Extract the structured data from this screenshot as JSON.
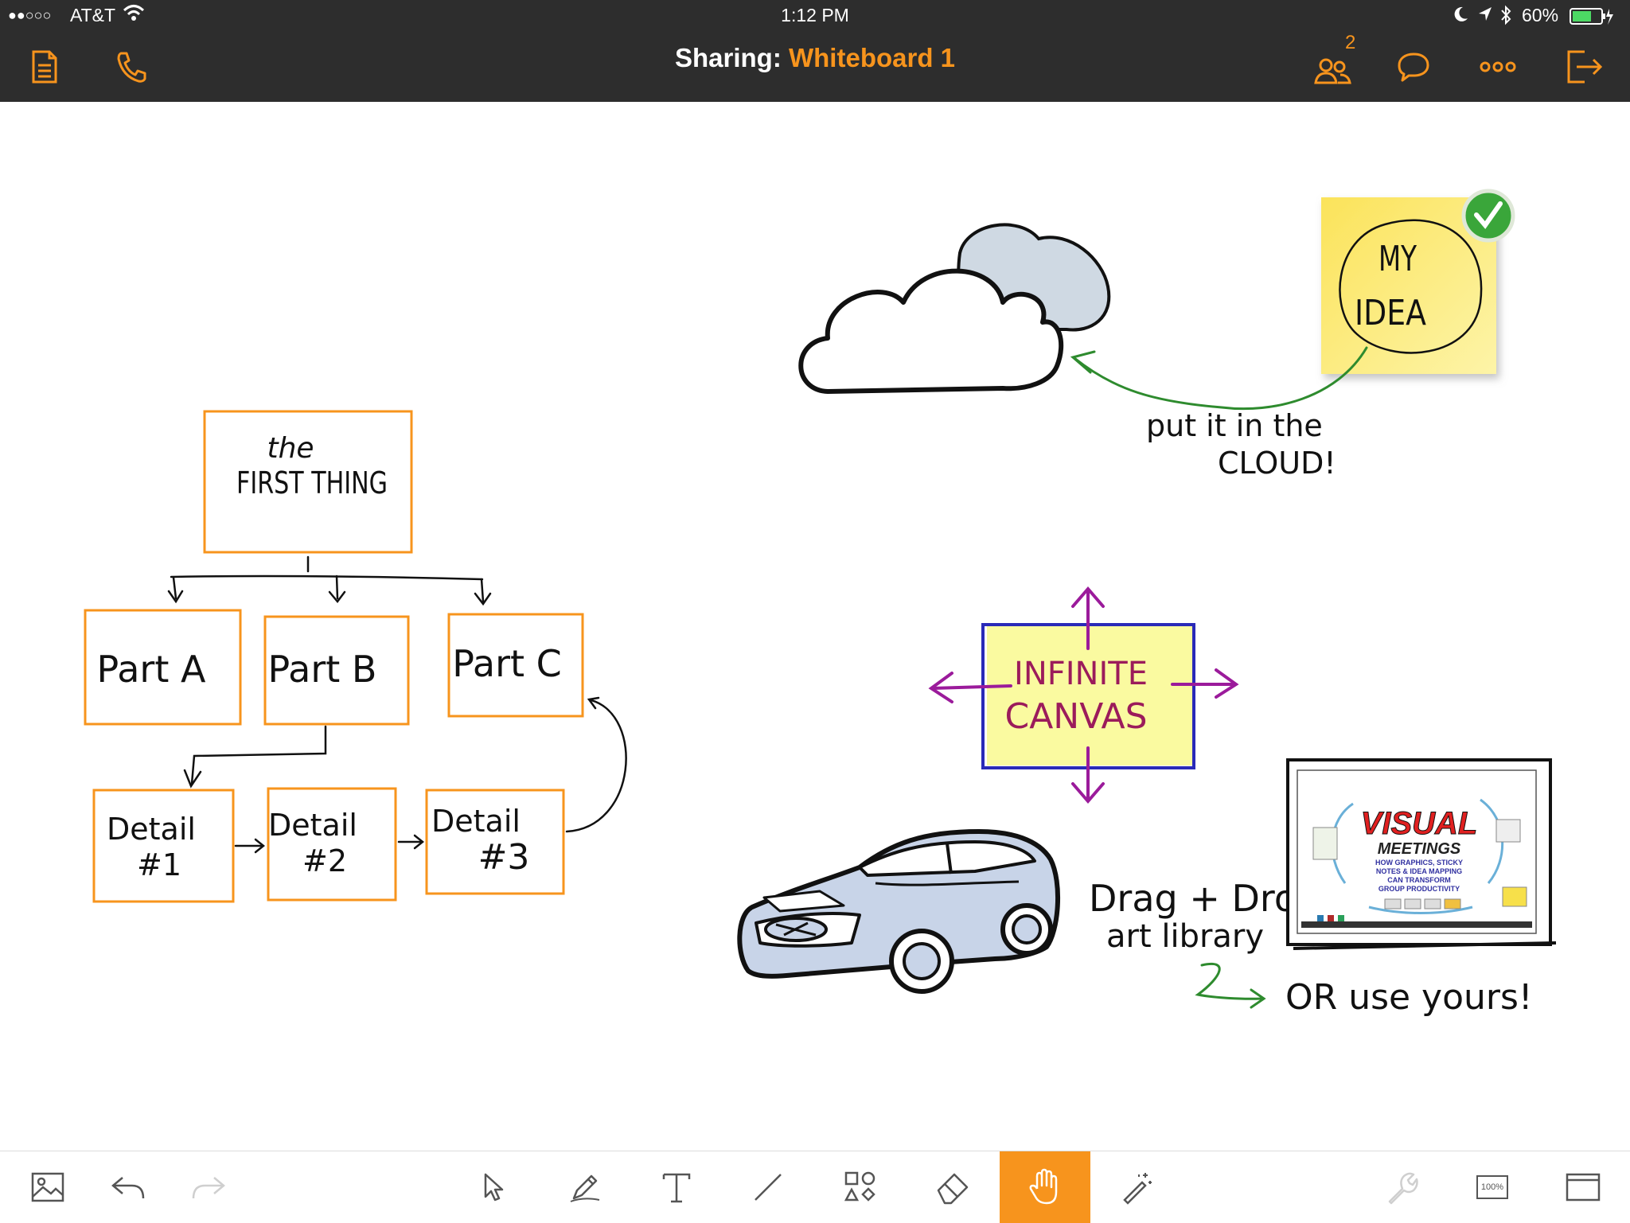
{
  "status_bar": {
    "signal": "●●○○○",
    "carrier": "AT&T",
    "time": "1:12 PM",
    "battery": "60%"
  },
  "title_bar": {
    "prefix": "Sharing:",
    "board_name": "Whiteboard 1",
    "participants_count": "2"
  },
  "canvas": {
    "flowchart": {
      "top_line1": "the",
      "top_line2": "FIRST THING",
      "part_a": "Part A",
      "part_b": "Part B",
      "part_c": "Part C",
      "detail1_l1": "Detail",
      "detail1_l2": "#1",
      "detail2_l1": "Detail",
      "detail2_l2": "#2",
      "detail3_l1": "Detail",
      "detail3_l2": "#3"
    },
    "sticky": {
      "line1": "MY",
      "line2": "IDEA"
    },
    "cloud_note": {
      "line1": "put it in the",
      "line2": "CLOUD!"
    },
    "infinite": {
      "line1": "INFINITE",
      "line2": "CANVAS"
    },
    "drag_note": {
      "line1": "Drag + Drop",
      "line2": "art library"
    },
    "or_note": "OR use yours!",
    "book": {
      "title1": "VISUAL",
      "title2": "MEETINGS",
      "subtitle1": "HOW GRAPHICS, STICKY",
      "subtitle2": "NOTES & IDEA MAPPING",
      "subtitle3": "CAN TRANSFORM",
      "subtitle4": "GROUP PRODUCTIVITY"
    }
  },
  "toolbar": {
    "zoom_label": "100%"
  },
  "colors": {
    "orange": "#f7941d",
    "dark_bar": "#2d2d2d",
    "green_arrow": "#2e8b2e",
    "purple": "#9b1b9b",
    "sticky_yellow": "#fbe86a"
  }
}
